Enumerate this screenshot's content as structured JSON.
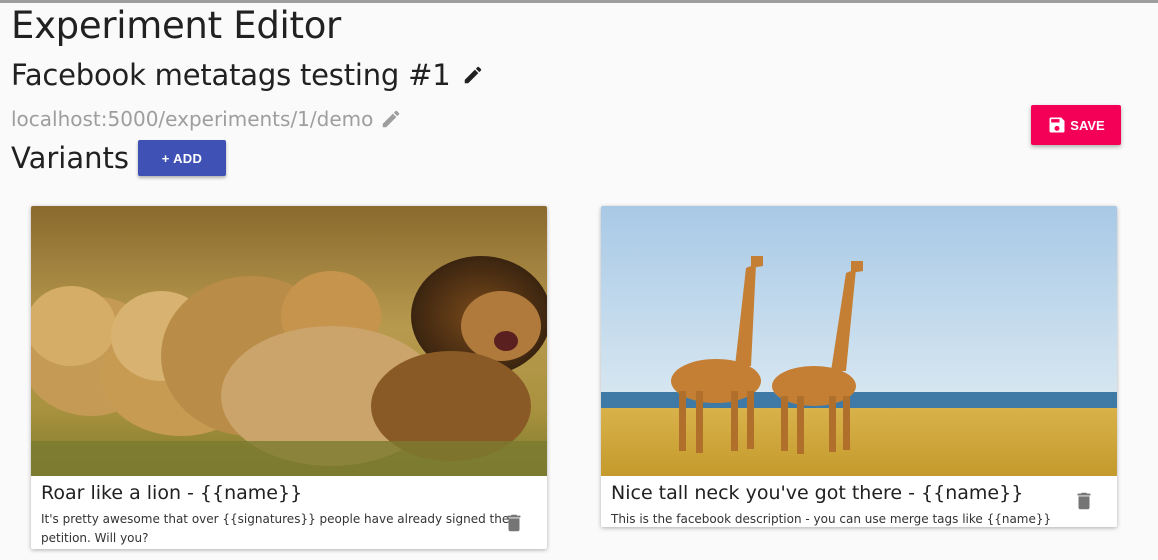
{
  "page": {
    "title": "Experiment Editor",
    "experiment_name": "Facebook metatags testing #1",
    "url": "localhost:5000/experiments/1/demo",
    "variants_heading": "Variants",
    "add_label": "+ ADD",
    "save_label": "SAVE"
  },
  "variants": [
    {
      "title": "Roar like a lion - {{name}}",
      "description": "It's pretty awesome that over {{signatures}} people have already signed the petition. Will you?"
    },
    {
      "title": "Nice tall neck you've got there - {{name}}",
      "description": "This is the facebook description - you can use merge tags like {{name}}"
    }
  ],
  "icons": {
    "edit_title": "pencil-icon",
    "edit_url": "pencil-icon",
    "save": "floppy-disk-icon",
    "delete": "trash-icon"
  },
  "colors": {
    "primary": "#3f51b5",
    "accent": "#f50057"
  }
}
